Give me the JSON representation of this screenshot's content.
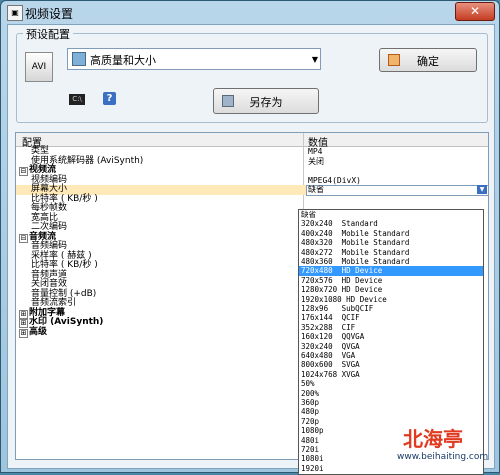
{
  "window": {
    "title": "视频设置",
    "close": "✕"
  },
  "preset": {
    "group_label": "预设配置",
    "icon_label": "AVI",
    "selected": "高质量和大小",
    "confirm_label": "确定",
    "cmd_icon": "C:\\",
    "help_icon": "?",
    "save_as_label": "另存为"
  },
  "grid": {
    "header_config": "配置",
    "header_value": "数值",
    "rows": [
      {
        "name": "类型",
        "value": "MP4"
      },
      {
        "name": "使用系统解码器 (AviSynth)",
        "value": "关闭"
      },
      {
        "name": "视频流",
        "value": "",
        "exp": "⊟"
      },
      {
        "name": "视频编码",
        "value": "MPEG4(DivX)"
      },
      {
        "name": "屏幕大小",
        "value": "缺省"
      },
      {
        "name": "比特率 ( KB/秒 )",
        "value": ""
      },
      {
        "name": "每秒帧数",
        "value": ""
      },
      {
        "name": "宽高比",
        "value": ""
      },
      {
        "name": "二次编码",
        "value": ""
      },
      {
        "name": "音频流",
        "value": "",
        "exp": "⊟"
      },
      {
        "name": "音频编码",
        "value": ""
      },
      {
        "name": "采样率 ( 赫兹 )",
        "value": ""
      },
      {
        "name": "比特率 ( KB/秒 )",
        "value": ""
      },
      {
        "name": "音频声道",
        "value": ""
      },
      {
        "name": "关闭音效",
        "value": ""
      },
      {
        "name": "音量控制 (+dB)",
        "value": ""
      },
      {
        "name": "音频流索引",
        "value": ""
      },
      {
        "name": "附加字幕",
        "value": "",
        "exp": "⊞"
      },
      {
        "name": "水印 (AviSynth)",
        "value": "",
        "exp": "⊞"
      },
      {
        "name": "高级",
        "value": "",
        "exp": "⊞"
      }
    ]
  },
  "dropdown": {
    "options": [
      "缺省",
      "320x240  Standard",
      "400x240  Mobile Standard",
      "480x320  Mobile Standard",
      "480x272  Mobile Standard",
      "480x360  Mobile Standard",
      "720x480  HD Device",
      "720x576  HD Device",
      "1280x720 HD Device",
      "1920x1080 HD Device",
      "128x96   SubQCIF",
      "176x144  QCIF",
      "352x288  CIF",
      "160x120  QQVGA",
      "320x240  QVGA",
      "640x480  VGA",
      "800x600  SVGA",
      "1024x768 XVGA",
      "50%",
      "200%",
      "360p",
      "480p",
      "720p",
      "1080p",
      "480i",
      "720i",
      "1080i",
      "1920i"
    ],
    "selected_index": 6
  },
  "watermark": {
    "text": "北海亭",
    "url": "www.beihaiting.com",
    "color": "#e03a20"
  }
}
